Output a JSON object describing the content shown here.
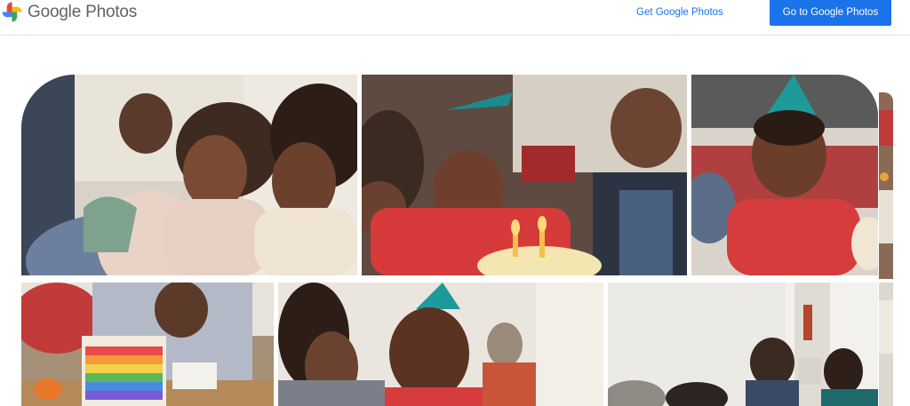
{
  "header": {
    "brand_text": "Google Photos",
    "get_link_label": "Get Google Photos",
    "go_button_label": "Go to Google Photos",
    "brand_colors": [
      "#ea4335",
      "#fbbc04",
      "#34a853",
      "#4285f4"
    ],
    "accent_color": "#1a73e8"
  },
  "gallery": {
    "photos": [
      {
        "id": "photo-girls-laughing",
        "icon": "photo"
      },
      {
        "id": "photo-boy-blowing-candles",
        "icon": "photo"
      },
      {
        "id": "photo-boy-party-hat-smiling",
        "icon": "photo"
      },
      {
        "id": "photo-edge-right-top",
        "icon": "photo"
      },
      {
        "id": "photo-rainbow-cake",
        "icon": "photo"
      },
      {
        "id": "photo-girl-and-boy-party-hat",
        "icon": "photo"
      },
      {
        "id": "photo-family-table",
        "icon": "photo"
      },
      {
        "id": "photo-edge-right-bottom",
        "icon": "photo"
      }
    ]
  }
}
